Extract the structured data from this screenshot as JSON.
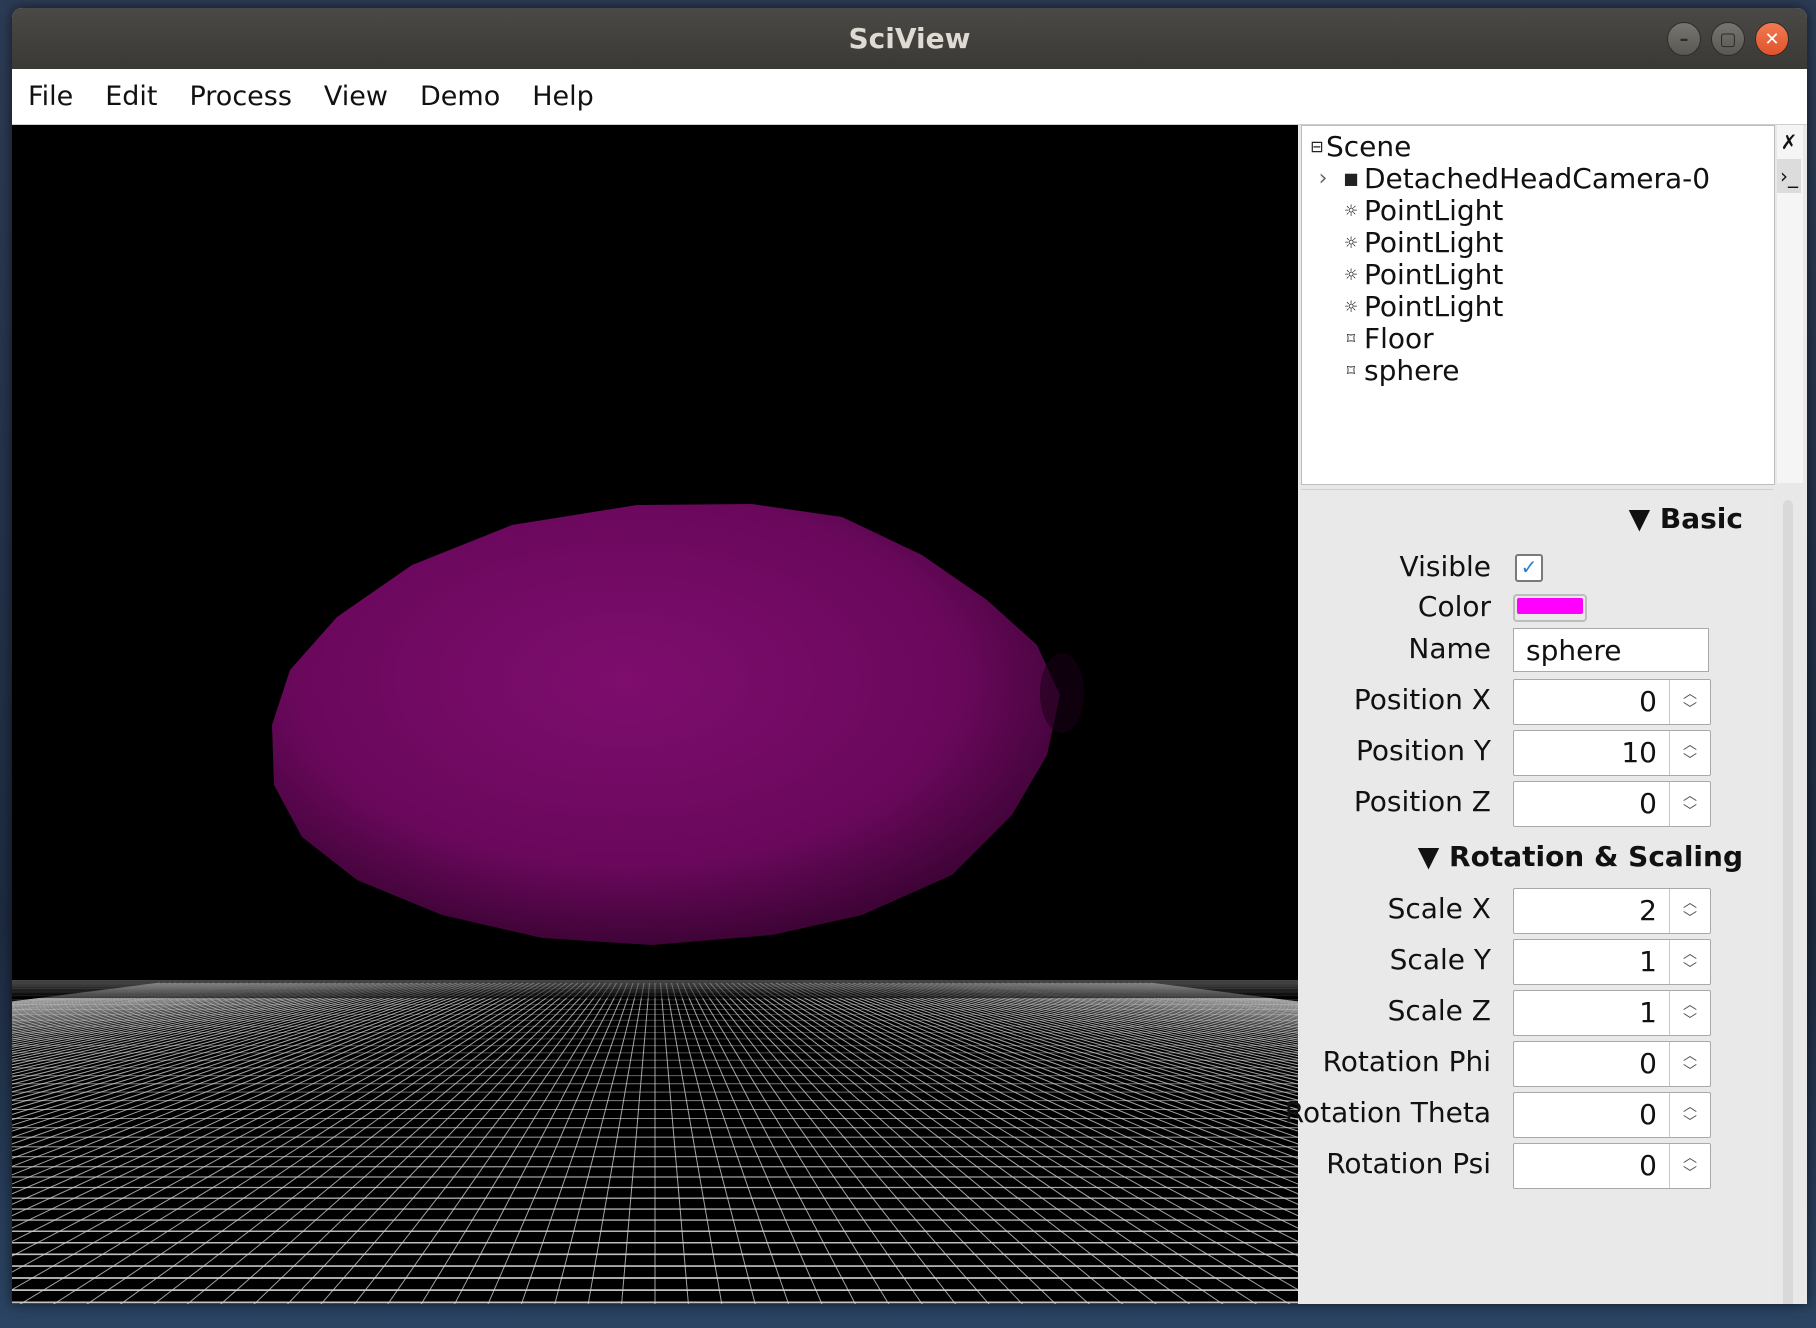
{
  "window": {
    "title": "SciView"
  },
  "menu": [
    "File",
    "Edit",
    "Process",
    "View",
    "Demo",
    "Help"
  ],
  "tree": {
    "root": "Scene",
    "nodes": [
      {
        "label": "DetachedHeadCamera-0",
        "icon": "camera-icon",
        "expandable": true
      },
      {
        "label": "PointLight",
        "icon": "light-icon"
      },
      {
        "label": "PointLight",
        "icon": "light-icon"
      },
      {
        "label": "PointLight",
        "icon": "light-icon"
      },
      {
        "label": "PointLight",
        "icon": "light-icon"
      },
      {
        "label": "Floor",
        "icon": "mesh-icon"
      },
      {
        "label": "sphere",
        "icon": "mesh-icon"
      }
    ]
  },
  "properties": {
    "basic_title": "▼ Basic",
    "visible_label": "Visible",
    "visible": true,
    "color_label": "Color",
    "color_value": "#ff00ff",
    "name_label": "Name",
    "name_value": "sphere",
    "pos_x_label": "Position X",
    "pos_x": "0",
    "pos_y_label": "Position Y",
    "pos_y": "10",
    "pos_z_label": "Position Z",
    "pos_z": "0",
    "rot_title": "▼ Rotation & Scaling",
    "scale_x_label": "Scale X",
    "scale_x": "2",
    "scale_y_label": "Scale Y",
    "scale_y": "1",
    "scale_z_label": "Scale Z",
    "scale_z": "1",
    "rot_phi_label": "Rotation Phi",
    "rot_phi": "0",
    "rot_theta_label": "Rotation Theta",
    "rot_theta": "0",
    "rot_psi_label": "Rotation Psi",
    "rot_psi": "0"
  },
  "colors": {
    "sphere": "#7a0a6a",
    "background": "#000000",
    "grid": "#d9d9d9"
  }
}
